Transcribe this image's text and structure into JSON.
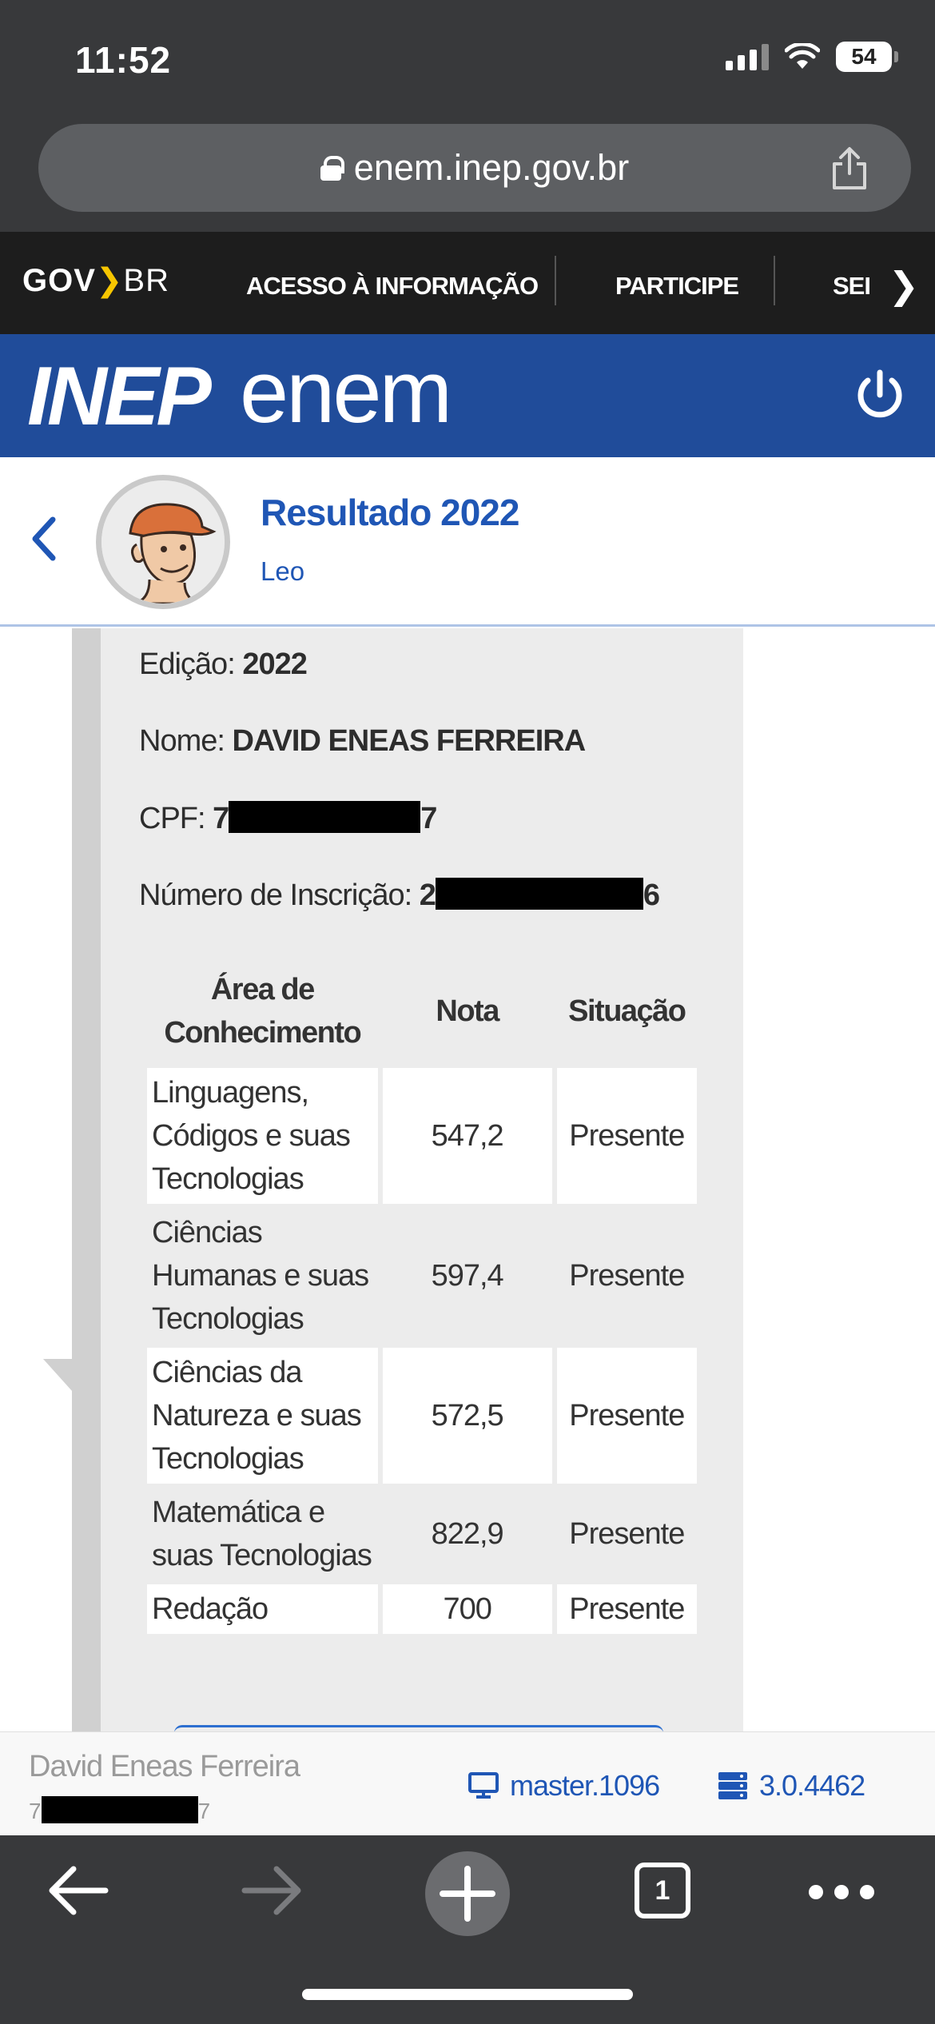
{
  "status_bar": {
    "time": "11:52",
    "battery": "54"
  },
  "browser": {
    "url": "enem.inep.gov.br"
  },
  "gov_bar": {
    "logo_gov": "GOV",
    "logo_br": "BR",
    "links": [
      "ACESSO À INFORMAÇÃO",
      "PARTICIPE",
      "SEI"
    ]
  },
  "brand": {
    "inep": "INEP",
    "enem": "enem"
  },
  "page": {
    "title": "Resultado 2022",
    "subtitle": "Leo"
  },
  "candidate": {
    "edicao_label": "Edição:",
    "edicao_value": "2022",
    "nome_label": "Nome:",
    "nome_value": "DAVID ENEAS FERREIRA",
    "cpf_label": "CPF:",
    "cpf_first": "7",
    "cpf_last": "7",
    "inscricao_label": "Número de Inscrição:",
    "inscricao_first": "2",
    "inscricao_last": "6"
  },
  "results": {
    "headers": {
      "area": "Área de Conhecimento",
      "nota": "Nota",
      "situacao": "Situação"
    },
    "rows": [
      {
        "area": "Linguagens, Códigos e suas Tecnologias",
        "nota": "547,2",
        "situacao": "Presente"
      },
      {
        "area": "Ciências Humanas e suas Tecnologias",
        "nota": "597,4",
        "situacao": "Presente"
      },
      {
        "area": "Ciências da Natureza e suas Tecnologias",
        "nota": "572,5",
        "situacao": "Presente"
      },
      {
        "area": "Matemática e suas Tecnologias",
        "nota": "822,9",
        "situacao": "Presente"
      },
      {
        "area": "Redação",
        "nota": "700",
        "situacao": "Presente"
      }
    ]
  },
  "footer": {
    "user_name": "David Eneas Ferreira",
    "cpf_first": "7",
    "cpf_last": "7",
    "frontend_version": "master.1096",
    "backend_version": "3.0.4462"
  },
  "toolbar": {
    "tab_count": "1"
  },
  "colors": {
    "inep_blue": "#204c9a",
    "link_blue": "#1f56b5",
    "chrome_dark": "#38393b",
    "gov_black": "#1d1d1d"
  }
}
